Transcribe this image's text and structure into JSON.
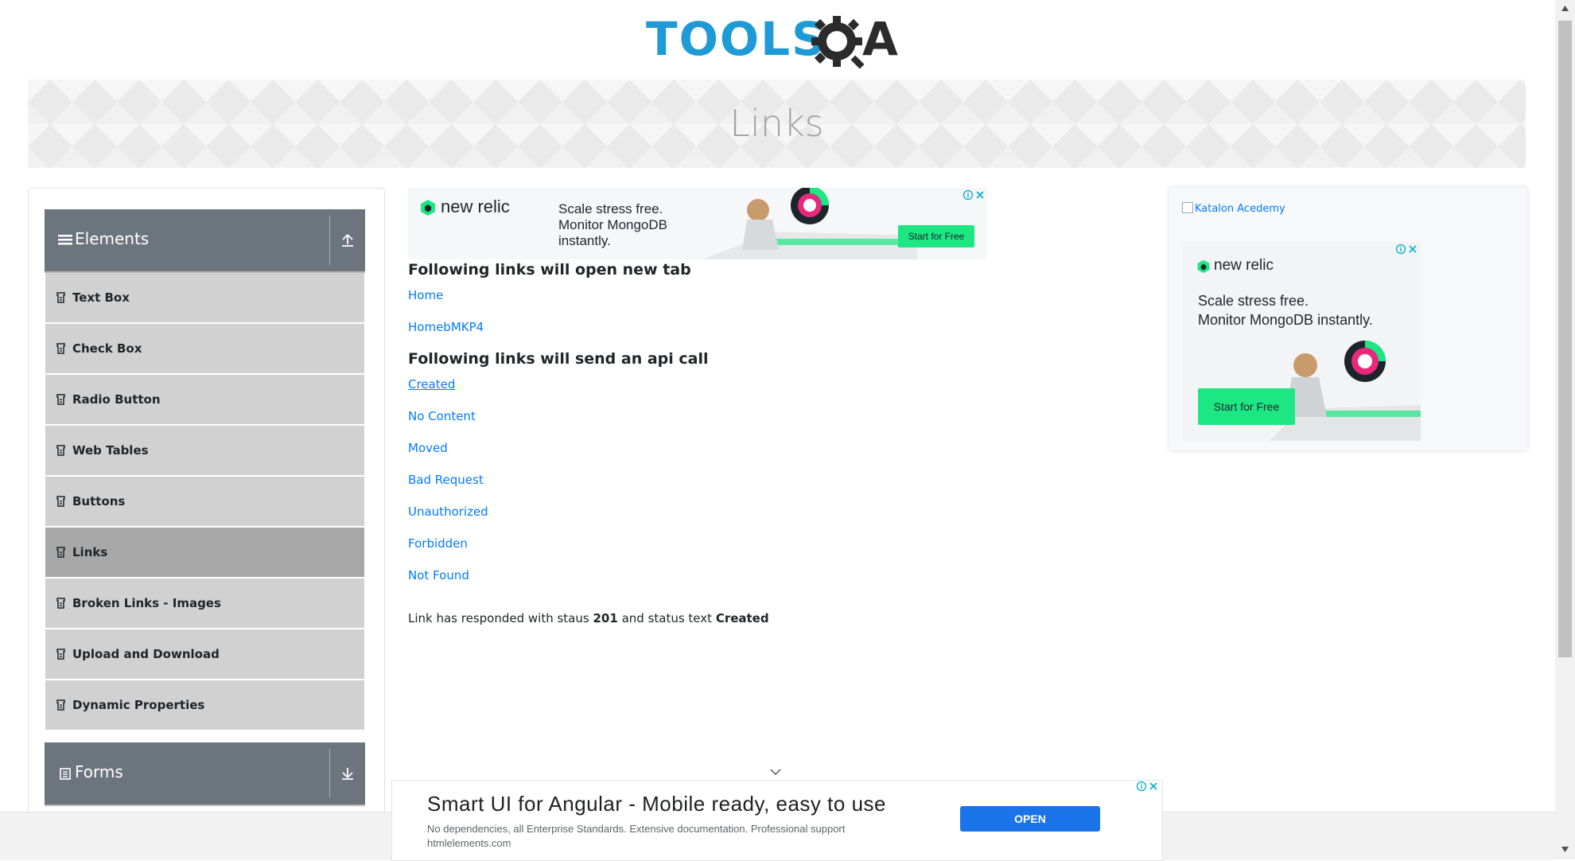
{
  "header": {
    "logo_part1": "TOOLS",
    "logo_part2": "A",
    "logo_brand_colors": {
      "primary": "#1e9bd7",
      "dark": "#2b2b2b"
    }
  },
  "banner": {
    "title": "Links"
  },
  "sidebar": {
    "elements_group": {
      "label": "Elements",
      "icon": "hamburger-icon",
      "toggle_icon": "collapse-up-icon",
      "items": [
        {
          "label": "Text Box"
        },
        {
          "label": "Check Box"
        },
        {
          "label": "Radio Button"
        },
        {
          "label": "Web Tables"
        },
        {
          "label": "Buttons"
        },
        {
          "label": "Links",
          "active": true
        },
        {
          "label": "Broken Links - Images"
        },
        {
          "label": "Upload and Download"
        },
        {
          "label": "Dynamic Properties"
        }
      ]
    },
    "forms_group": {
      "label": "Forms",
      "icon": "form-icon",
      "toggle_icon": "expand-down-icon"
    },
    "colors": {
      "header": "#6c757d",
      "item": "#d1d1d1",
      "item_active": "#a8a8a8"
    }
  },
  "top_ad": {
    "brand": "new relic",
    "headline_line1": "Scale stress free.",
    "headline_line2": "Monitor MongoDB",
    "headline_line3": "instantly.",
    "cta": "Start for Free"
  },
  "main": {
    "new_tab_heading": "Following links will open new tab",
    "new_tab_links": [
      "Home",
      "HomebMKP4"
    ],
    "api_heading": "Following links will send an api call",
    "api_links": [
      "Created",
      "No Content",
      "Moved",
      "Bad Request",
      "Unauthorized",
      "Forbidden",
      "Not Found"
    ],
    "response": {
      "prefix": "Link has responded with staus",
      "status_code": "201",
      "middle": "and status text",
      "status_text": "Created"
    },
    "link_color": "#007bff"
  },
  "right_ad": {
    "broken_image_alt": "Katalon Acedemy",
    "brand": "new relic",
    "headline_line1": "Scale stress free.",
    "headline_line2": "Monitor MongoDB instantly.",
    "cta": "Start for Free"
  },
  "bottom_ad": {
    "title": "Smart UI for Angular - Mobile ready, easy to use",
    "description": "No dependencies, all Enterprise Standards. Extensive documentation. Professional support",
    "domain": "htmlelements.com",
    "cta": "OPEN"
  }
}
